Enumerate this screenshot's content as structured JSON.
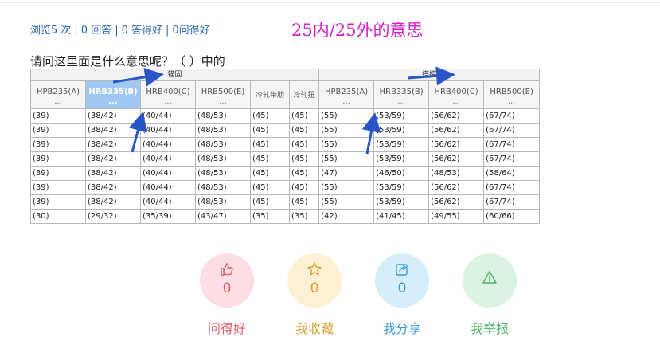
{
  "stats": {
    "views": "浏览5 次",
    "answers": "0 回答",
    "good_answers": "0 答得好",
    "good_questions": "0问得好",
    "separator": "|"
  },
  "annotation": "25内/25外的意思",
  "question": "请问这里面是什么意思呢？（ ）中的",
  "table": {
    "groups": [
      {
        "label": "锚固"
      },
      {
        "label": "搭接"
      }
    ],
    "columns": [
      {
        "label": "HPB235(A)",
        "ellipsis": "..."
      },
      {
        "label": "HRB335(B)",
        "ellipsis": "...",
        "highlighted": true
      },
      {
        "label": "HRB400(C)",
        "ellipsis": "..."
      },
      {
        "label": "HRB500(E)",
        "ellipsis": "..."
      },
      {
        "label": "冷轧带肋",
        "ellipsis": ""
      },
      {
        "label": "冷轧扭",
        "ellipsis": ""
      },
      {
        "label": "HPB235(A)",
        "ellipsis": "..."
      },
      {
        "label": "HRB335(B)",
        "ellipsis": "..."
      },
      {
        "label": "HRB400(C)",
        "ellipsis": "..."
      },
      {
        "label": "HRB500(E)",
        "ellipsis": "..."
      }
    ],
    "rows": [
      [
        "(39)",
        "(38/42)",
        "(40/44)",
        "(48/53)",
        "(45)",
        "(45)",
        "(55)",
        "(53/59)",
        "(56/62)",
        "(67/74)"
      ],
      [
        "(39)",
        "(38/42)",
        "(40/44)",
        "(48/53)",
        "(45)",
        "(45)",
        "(55)",
        "(53/59)",
        "(56/62)",
        "(67/74)"
      ],
      [
        "(39)",
        "(38/42)",
        "(40/44)",
        "(48/53)",
        "(45)",
        "(45)",
        "(55)",
        "(53/59)",
        "(56/62)",
        "(67/74)"
      ],
      [
        "(39)",
        "(38/42)",
        "(40/44)",
        "(48/53)",
        "(45)",
        "(45)",
        "(55)",
        "(53/59)",
        "(56/62)",
        "(67/74)"
      ],
      [
        "(39)",
        "(38/42)",
        "(40/44)",
        "(48/53)",
        "(45)",
        "(45)",
        "(47)",
        "(46/50)",
        "(48/53)",
        "(58/64)"
      ],
      [
        "(39)",
        "(38/42)",
        "(40/44)",
        "(48/53)",
        "(45)",
        "(45)",
        "(55)",
        "(53/59)",
        "(56/62)",
        "(67/74)"
      ],
      [
        "(39)",
        "(38/42)",
        "(40/44)",
        "(48/53)",
        "(45)",
        "(45)",
        "(55)",
        "(53/59)",
        "(56/62)",
        "(67/74)"
      ],
      [
        "(30)",
        "(29/32)",
        "(35/39)",
        "(43/47)",
        "(35)",
        "(35)",
        "(42)",
        "(41/45)",
        "(49/55)",
        "(60/66)"
      ]
    ]
  },
  "actions": [
    {
      "name": "good-question",
      "icon": "thumbs-up-icon",
      "count": "0",
      "label": "问得好",
      "color": "#e0606a",
      "bg": "#fbdfe2"
    },
    {
      "name": "favorite",
      "icon": "star-icon",
      "count": "0",
      "label": "我收藏",
      "color": "#d9a035",
      "bg": "#fdf0d4"
    },
    {
      "name": "share",
      "icon": "share-icon",
      "count": "0",
      "label": "我分享",
      "color": "#3b9bd9",
      "bg": "#d6eefa"
    },
    {
      "name": "report",
      "icon": "warning-icon",
      "count": "",
      "label": "我举报",
      "color": "#4db26a",
      "bg": "#dbf3e0"
    }
  ],
  "colors": {
    "stats_link": "#2d6aa8",
    "annotation": "#d61fc8",
    "arrow": "#2a55c8",
    "highlight_header": "#9ec8f2"
  }
}
